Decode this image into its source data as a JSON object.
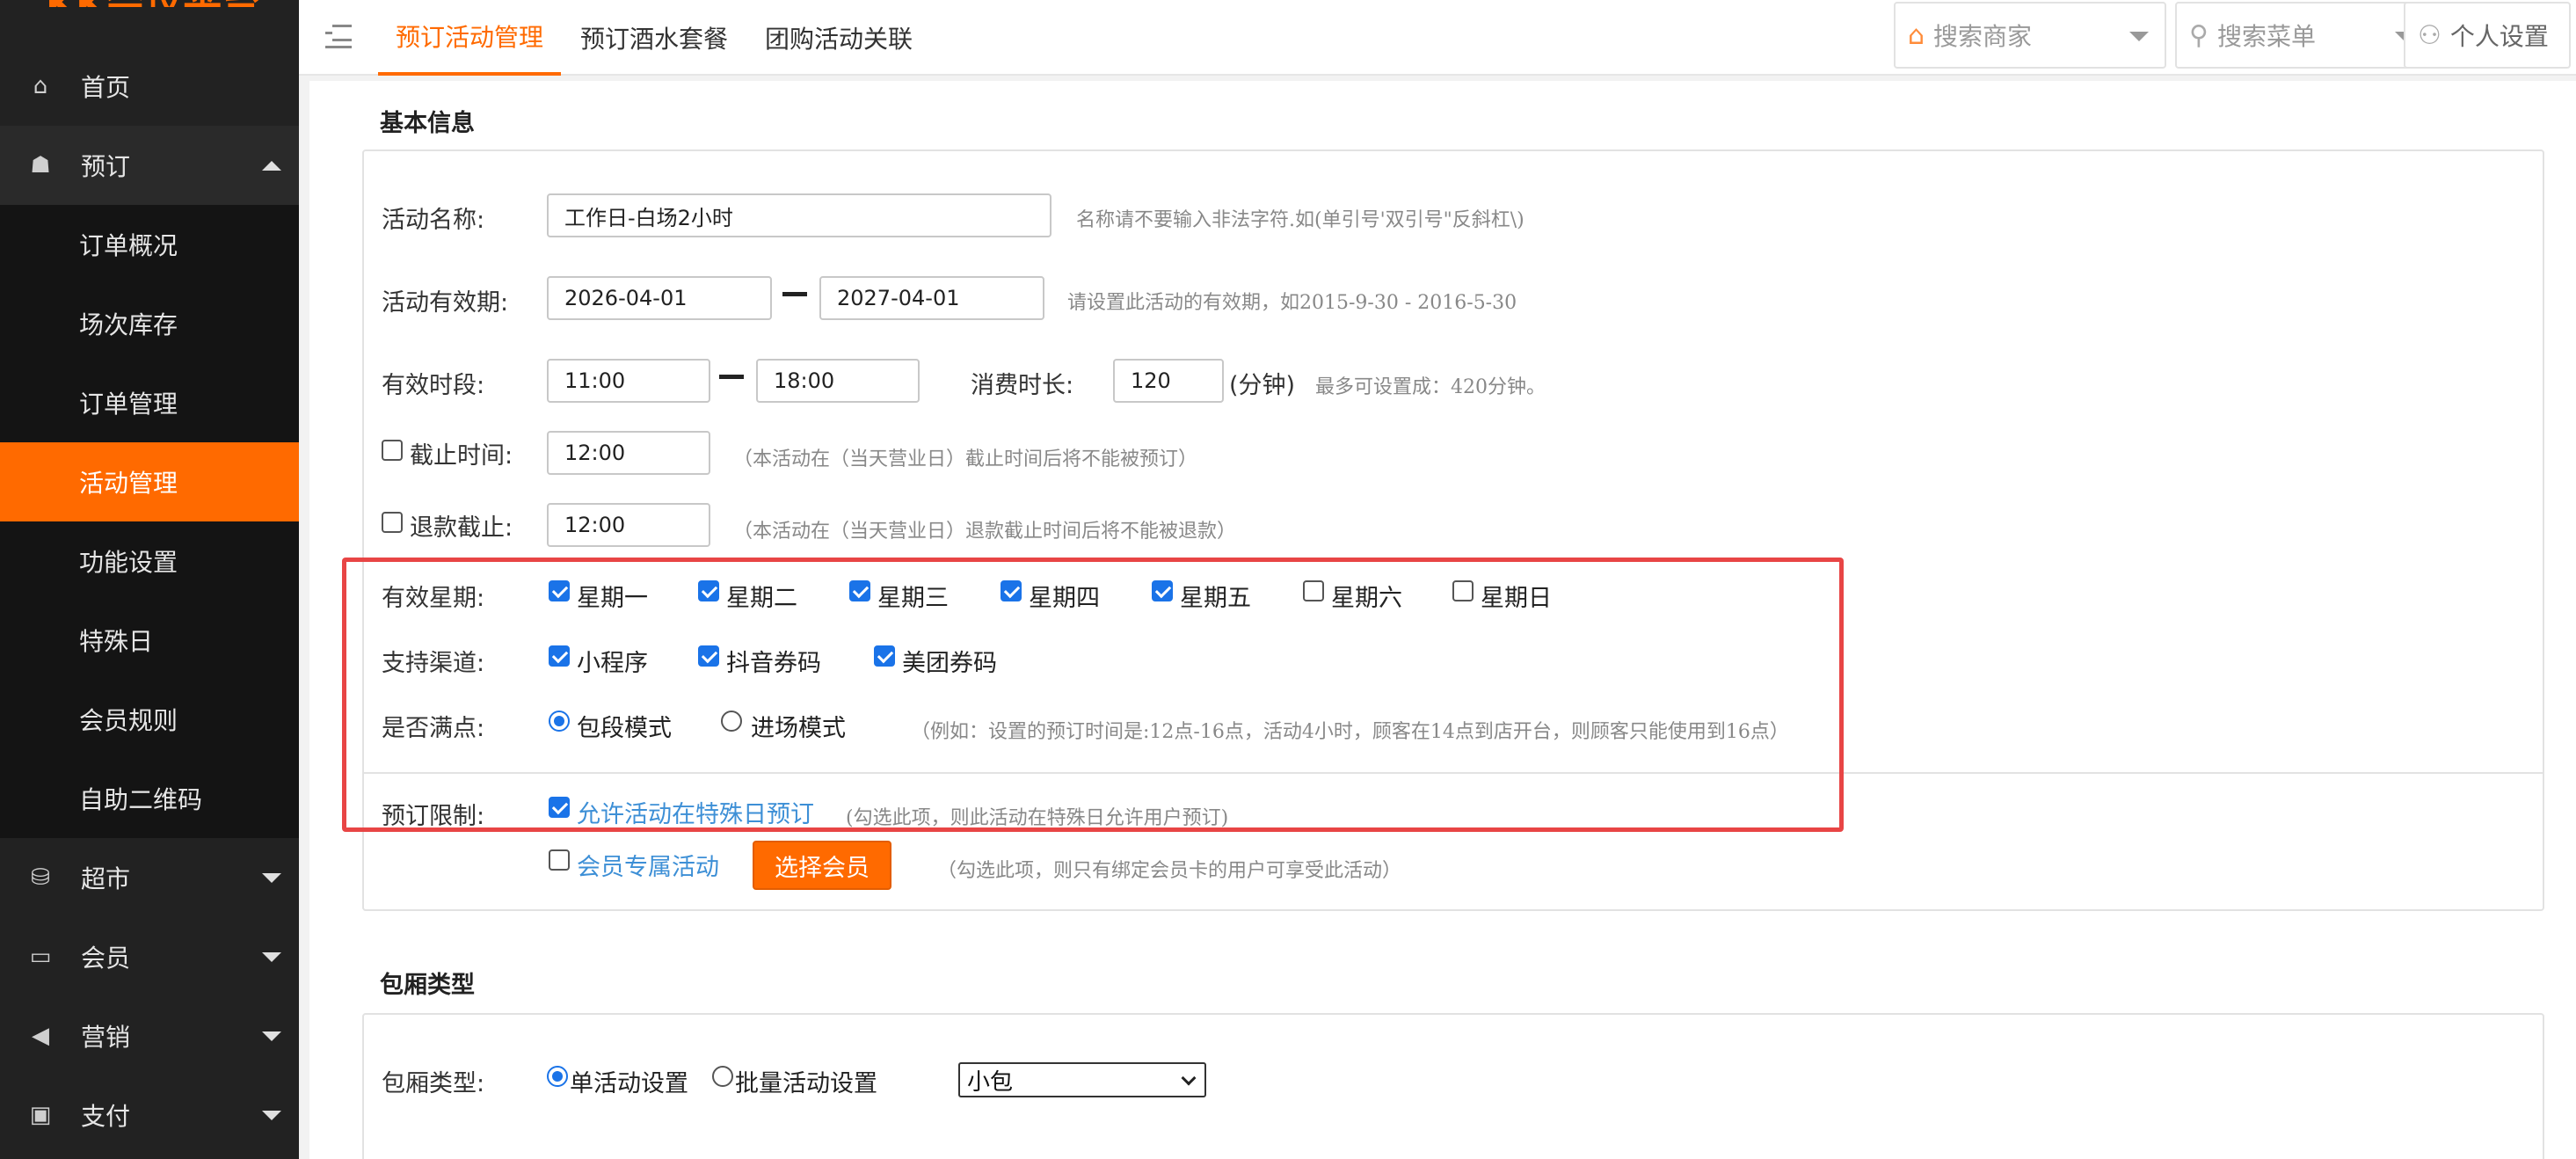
{
  "sidebar": {
    "logo": "KK会议平台",
    "items": [
      {
        "label": "首页",
        "icon": "home-icon"
      },
      {
        "label": "预订",
        "icon": "booking-icon"
      },
      {
        "label": "订单概况"
      },
      {
        "label": "场次库存"
      },
      {
        "label": "订单管理"
      },
      {
        "label": "活动管理"
      },
      {
        "label": "功能设置"
      },
      {
        "label": "特殊日"
      },
      {
        "label": "会员规则"
      },
      {
        "label": "自助二维码"
      },
      {
        "label": "超市",
        "icon": "basket-icon"
      },
      {
        "label": "会员",
        "icon": "card-icon"
      },
      {
        "label": "营销",
        "icon": "megaphone-icon"
      },
      {
        "label": "支付",
        "icon": "money-icon"
      }
    ]
  },
  "header": {
    "tabs": [
      "预订活动管理",
      "预订酒水套餐",
      "团购活动关联"
    ],
    "search_merchant": "搜索商家",
    "search_menu": "搜索菜单",
    "personal_settings": "个人设置"
  },
  "basic": {
    "title": "基本信息",
    "name_label": "活动名称:",
    "name_value": "工作日-白场2小时",
    "name_hint": "名称请不要输入非法字符.如(单引号'双引号\"反斜杠\\)",
    "period_label": "活动有效期:",
    "period_start": "2026-04-01",
    "period_end": "2027-04-01",
    "period_hint": "请设置此活动的有效期，如2015-9-30 - 2016-5-30",
    "time_label": "有效时段:",
    "time_start": "11:00",
    "time_end": "18:00",
    "duration_label": "消费时长:",
    "duration_value": "120",
    "duration_unit": "(分钟)",
    "duration_hint": "最多可设置成：420分钟。",
    "cutoff_label": "截止时间:",
    "cutoff_value": "12:00",
    "cutoff_hint": "（本活动在（当天营业日）截止时间后将不能被预订）",
    "refund_label": "退款截止:",
    "refund_value": "12:00",
    "refund_hint": "（本活动在（当天营业日）退款截止时间后将不能被退款）",
    "weekday_label": "有效星期:",
    "weekdays": [
      {
        "label": "星期一",
        "checked": true
      },
      {
        "label": "星期二",
        "checked": true
      },
      {
        "label": "星期三",
        "checked": true
      },
      {
        "label": "星期四",
        "checked": true
      },
      {
        "label": "星期五",
        "checked": true
      },
      {
        "label": "星期六",
        "checked": false
      },
      {
        "label": "星期日",
        "checked": false
      }
    ],
    "channel_label": "支持渠道:",
    "channels": [
      {
        "label": "小程序",
        "checked": true
      },
      {
        "label": "抖音券码",
        "checked": true
      },
      {
        "label": "美团券码",
        "checked": true
      }
    ],
    "full_label": "是否满点:",
    "full_options": [
      {
        "label": "包段模式",
        "selected": true
      },
      {
        "label": "进场模式",
        "selected": false
      }
    ],
    "full_hint": "（例如：设置的预订时间是:12点-16点，活动4小时，顾客在14点到店开台，则顾客只能使用到16点）",
    "limit_label": "预订限制:",
    "special_day_label": "允许活动在特殊日预订",
    "special_day_hint": "(勾选此项，则此活动在特殊日允许用户预订)",
    "member_only_label": "会员专属活动",
    "select_member_button": "选择会员",
    "member_hint": "（勾选此项，则只有绑定会员卡的用户可享受此活动）"
  },
  "room": {
    "title": "包厢类型",
    "type_label": "包厢类型:",
    "single_label": "单活动设置",
    "batch_label": "批量活动设置",
    "select_value": "小包"
  },
  "colors": {
    "accent": "#ff6a00",
    "sidebar_bg": "#222222",
    "highlight": "#e84545",
    "link": "#3d8fd6"
  }
}
